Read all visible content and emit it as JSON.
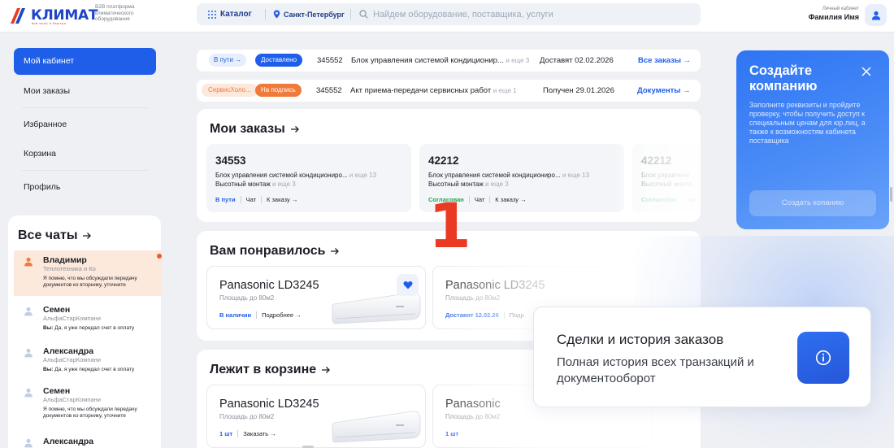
{
  "header": {
    "logo_text": "КЛИМАТ",
    "logo_sub": "всё ясно и быстро",
    "platform_text": "B2B платформа климатического оборудования",
    "catalog_label": "Каталог",
    "city_label": "Санкт-Петербург",
    "search_placeholder": "Найдем оборудование, поставщика, услуги",
    "account_label": "Личный кабинет",
    "account_name": "Фамилия Имя"
  },
  "nav": {
    "items": [
      {
        "label": "Мой кабинет"
      },
      {
        "label": "Мои заказы"
      },
      {
        "label": "Избранное"
      },
      {
        "label": "Корзина"
      },
      {
        "label": "Профиль"
      }
    ]
  },
  "chats": {
    "title": "Все чаты",
    "items": [
      {
        "name": "Владимир",
        "company": "Теплотехника и Ко",
        "author": "",
        "message": "Я помню, что мы обсуждали передачу документов ко вторнику, уточните"
      },
      {
        "name": "Семен",
        "company": "АльфаСтарКомпани",
        "author": "Вы:",
        "message": "Да, я уже передал счет в оплату"
      },
      {
        "name": "Александра",
        "company": "АльфаСтарКомпани",
        "author": "Вы:",
        "message": "Да, я уже передал счет в оплату"
      },
      {
        "name": "Семен",
        "company": "АльфаСтарКомпани",
        "author": "",
        "message": "Я помню, что мы обсуждали передачу документов ко вторнику, уточните"
      },
      {
        "name": "Александра",
        "company": "",
        "author": "",
        "message": ""
      }
    ]
  },
  "notifications": [
    {
      "status_prev": "В пути",
      "status_arrow": "→",
      "status": "Доставлено",
      "number": "345552",
      "title": "Блок управления системой кондиционир...",
      "more": "и еще 3",
      "date": "Доставят 02.02.2026",
      "link": "Все заказы →"
    },
    {
      "status_prev": "СервисХоло...",
      "status_arrow": "",
      "status": "На подпись",
      "number": "345552",
      "title": "Акт приема-передачи сервисных работ",
      "more": "и еще 1",
      "date": "Получен 29.01.2026",
      "link": "Документы →"
    }
  ],
  "orders_section": {
    "title": "Мои заказы",
    "orders": [
      {
        "number": "34553",
        "line1": "Блок управления системой кондициониро...",
        "line1_more": "и еще 13",
        "line2": "Высотный монтаж",
        "line2_more": "и еще 3",
        "status": "В пути",
        "chat": "Чат",
        "link": "К заказу →"
      },
      {
        "number": "42212",
        "line1": "Блок управления системой кондициониро...",
        "line1_more": "и еще 13",
        "line2": "Высотный монтаж",
        "line2_more": "и еще 3",
        "status": "Согласован",
        "chat": "Чат",
        "link": "К заказу →"
      },
      {
        "number": "42212",
        "line1": "Блок управлени",
        "line1_more": "",
        "line2": "Высотный монта",
        "line2_more": "",
        "status": "Согласован",
        "chat": "Ча",
        "link": ""
      }
    ]
  },
  "liked_section": {
    "title": "Вам понравилось",
    "products": [
      {
        "name": "Panasonic LD3245",
        "area": "Площадь до 80м2",
        "status": "В наличии",
        "link": "Подробнее →"
      },
      {
        "name": "Panasonic LD3245",
        "area": "Площадь до 80м2",
        "status": "Доставят 12.02.26",
        "link": "Подр"
      }
    ]
  },
  "cart_section": {
    "title": "Лежит в корзине",
    "products": [
      {
        "name": "Panasonic LD3245",
        "area": "Площадь до 80м2",
        "qty": "1 шт",
        "link": "Заказать →"
      },
      {
        "name": "Panasonic",
        "area": "Площадь до 80м2",
        "qty": "1 шт",
        "link": ""
      }
    ]
  },
  "promo": {
    "title": "Создайте компанию",
    "text": "Заполните реквизиты и пройдите проверку, чтобы получить доступ к специальным ценам для юр.лиц, а также к возможностям кабинета поставщика",
    "button": "Создать копанию"
  },
  "tooltip": {
    "title": "Сделки и история заказов",
    "text": "Полная история всех транзакций и документооборот"
  },
  "annotation": {
    "label": "1"
  },
  "colors": {
    "accent": "#1f5ee8",
    "brand_red": "#e93a24",
    "success": "#1fa854",
    "orange": "#f07a3a"
  }
}
